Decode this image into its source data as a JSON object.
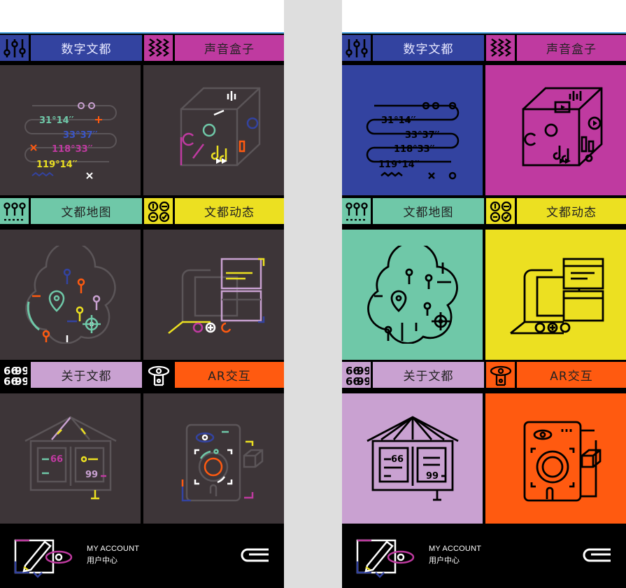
{
  "colors": {
    "blue": "#3343a0",
    "magenta": "#bf3aa0",
    "mint": "#6fc8a8",
    "yellow": "#ece021",
    "lilac": "#c9a1d1",
    "orange": "#ff5a10",
    "dark_tile": "#3d3538"
  },
  "menu": [
    {
      "label": "数字文都",
      "icon": "sliders-icon"
    },
    {
      "label": "声音盒子",
      "icon": "sound-wave-icon"
    },
    {
      "label": "文都地图",
      "icon": "map-pins-icon"
    },
    {
      "label": "文都动态",
      "icon": "dashboard-dials-icon"
    },
    {
      "label": "关于文都",
      "icon": "quote-marks-icon"
    },
    {
      "label": "AR交互",
      "icon": "eye-phone-icon"
    }
  ],
  "tiles": {
    "digital": {
      "lines": [
        "31°14′′",
        "33°37′′",
        "118°33′′",
        "119°14′′"
      ]
    },
    "about": {
      "quote_left": "66",
      "quote_right": "99"
    }
  },
  "footer": {
    "account_en": "MY ACCOUNT",
    "account_cn": "用户中心"
  }
}
